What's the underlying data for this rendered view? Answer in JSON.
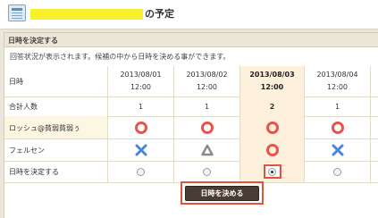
{
  "header": {
    "title": "の予定",
    "highlight_color": "#f7f22b"
  },
  "section": {
    "title": "日時を決定する",
    "description": "回答状況が表示されます。候補の中から日時を決める事ができます。"
  },
  "table": {
    "header_label": "日時",
    "columns": [
      {
        "date": "2013/08/01",
        "time": "12:00",
        "total": "1",
        "selected": false
      },
      {
        "date": "2013/08/02",
        "time": "12:00",
        "total": "1",
        "selected": false
      },
      {
        "date": "2013/08/03",
        "time": "12:00",
        "total": "2",
        "selected": true
      },
      {
        "date": "2013/08/04",
        "time": "12:00",
        "total": "1",
        "selected": false
      }
    ],
    "total_label": "合計人数",
    "participants": [
      {
        "name": "ロッシュ@貧弱貧弱ぅ",
        "answers": [
          "circle-icon",
          "circle-icon",
          "circle-icon",
          "circle-icon"
        ]
      },
      {
        "name": "フェルセン",
        "answers": [
          "cross-icon",
          "triangle-icon",
          "circle-icon",
          "cross-icon"
        ]
      }
    ],
    "decide_label": "日時を決定する"
  },
  "button": {
    "label": "日時を決める"
  },
  "colors": {
    "circle": "#e8534a",
    "cross": "#4a86d8",
    "triangle": "#8a8a8a",
    "highlight_frame": "#e0553a"
  }
}
